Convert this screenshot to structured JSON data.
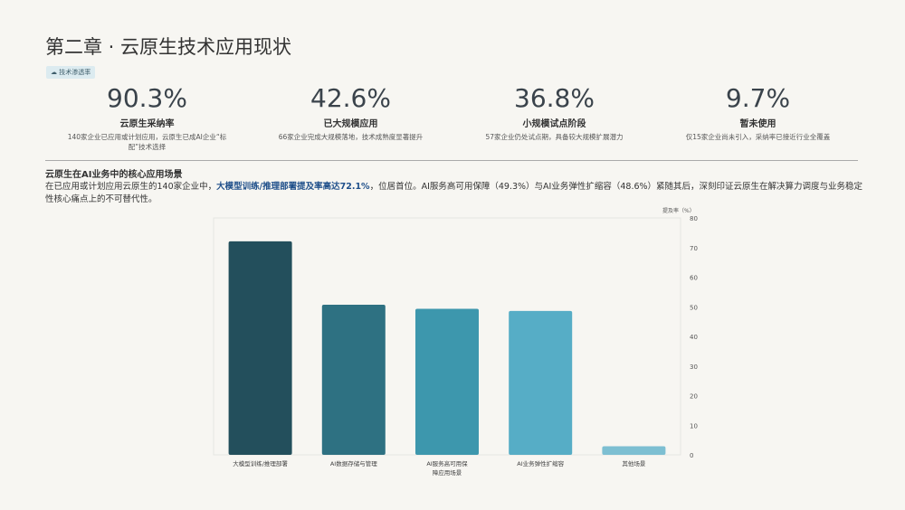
{
  "title": "第二章 · 云原生技术应用现状",
  "tag": "技术渗透率",
  "kpis": [
    {
      "value": "90.3%",
      "label": "云原生采纳率",
      "desc": "140家企业已应用或计划应用，云原生已成AI企业“标配”技术选择"
    },
    {
      "value": "42.6%",
      "label": "已大规模应用",
      "desc": "66家企业完成大规模落地，技术成熟度显著提升"
    },
    {
      "value": "36.8%",
      "label": "小规模试点阶段",
      "desc": "57家企业仍处试点期，具备较大规模扩展潜力"
    },
    {
      "value": "9.7%",
      "label": "暂未使用",
      "desc": "仅15家企业尚未引入，采纳率已接近行业全覆盖"
    }
  ],
  "section": {
    "title": "云原生在AI业务中的核心应用场景",
    "p1": "在已应用或计划应用云原生的140家企业中，",
    "highlight": "大模型训练/推理部署提及率高达72.1%",
    "p2": "，位居首位。AI服务高可用保障（49.3%）与AI业务弹性扩缩容（48.6%）紧随其后，深刻印证云原生在解决算力调度与业务稳定性核心痛点上的不可替代性。"
  },
  "chart_data": {
    "type": "bar",
    "categories": [
      "大模型训练/推理部署",
      "AI数据存储与管理",
      "AI服务高可用保障应用场景",
      "AI业务弹性扩缩容",
      "其他场景"
    ],
    "values": [
      72.1,
      50.7,
      49.3,
      48.6,
      2.9
    ],
    "ylabel": "提及率（%）",
    "ylim": [
      0,
      80
    ],
    "yticks": [
      0,
      10,
      20,
      30,
      40,
      50,
      60,
      70,
      80
    ],
    "colors": [
      "#234f5c",
      "#2e7182",
      "#3d97ad",
      "#56adc6",
      "#7dbfd2"
    ],
    "axis": "right"
  }
}
